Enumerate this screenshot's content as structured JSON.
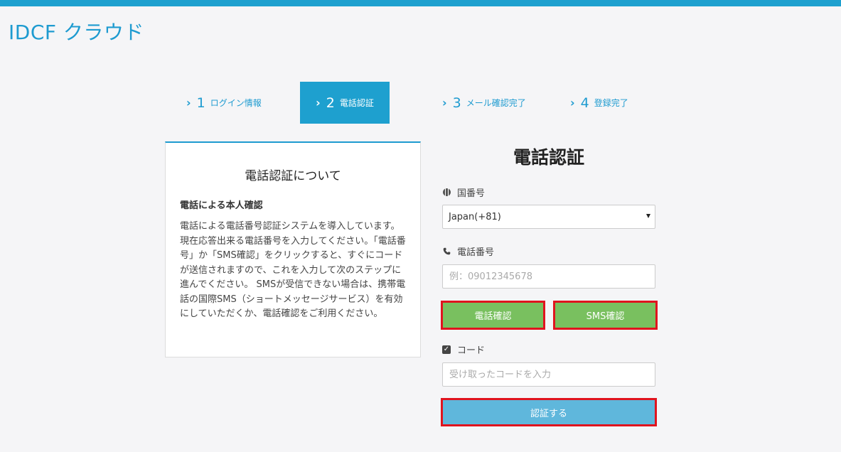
{
  "brand": {
    "title": "IDCF クラウド"
  },
  "steps": [
    {
      "chevron": "›",
      "num": "1",
      "label": "ログイン情報",
      "active": false
    },
    {
      "chevron": "›",
      "num": "2",
      "label": "電話認証",
      "active": true
    },
    {
      "chevron": "›",
      "num": "3",
      "label": "メール確認完了",
      "active": false
    },
    {
      "chevron": "›",
      "num": "4",
      "label": "登録完了",
      "active": false
    }
  ],
  "info": {
    "title": "電話認証について",
    "subtitle": "電話による本人確認",
    "body": "電話による電話番号認証システムを導入しています。現在応答出来る電話番号を入力してください。「電話番号」か「SMS確認」をクリックすると、すぐにコードが送信されますので、これを入力して次のステップに進んでください。 SMSが受信できない場合は、携帯電話の国際SMS（ショートメッセージサービス）を有効にしていただくか、電話確認をご利用ください。"
  },
  "form": {
    "title": "電話認証",
    "country_label": "国番号",
    "country_value": "Japan(+81)",
    "phone_label": "電話番号",
    "phone_placeholder": "例：09012345678",
    "call_button": "電話確認",
    "sms_button": "SMS確認",
    "code_label": "コード",
    "code_placeholder": "受け取ったコードを入力",
    "verify_button": "認証する"
  },
  "colors": {
    "accent": "#1ea0cf",
    "green_button": "#79c05f",
    "blue_button": "#5fb7dc",
    "highlight_border": "#e0141e"
  }
}
